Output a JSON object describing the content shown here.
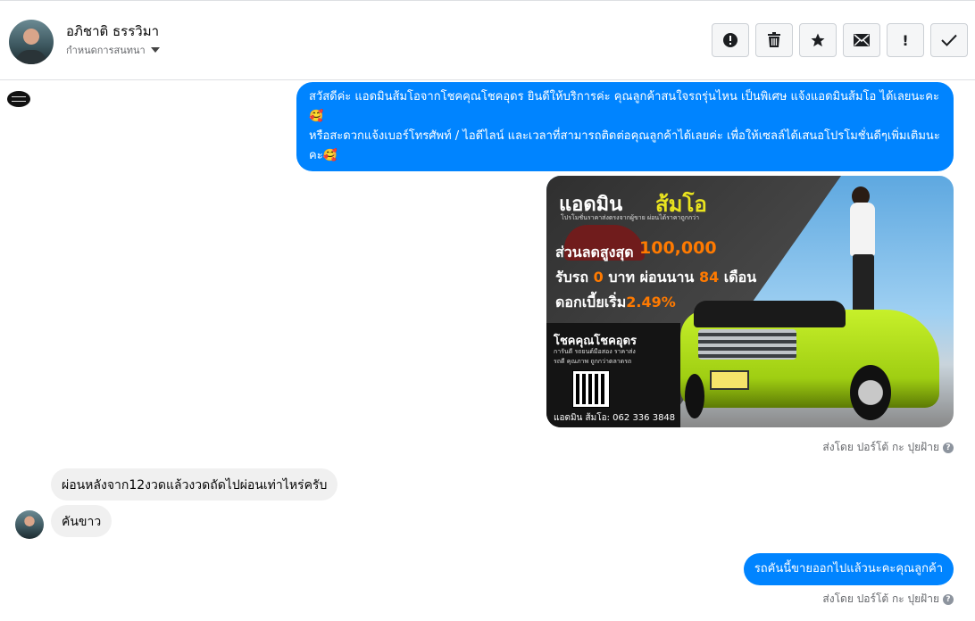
{
  "header": {
    "contact_name": "อภิชาติ ธรรวิมา",
    "assign_label": "กำหนดการสนทนา",
    "tools": [
      {
        "icon": "alert-circle-icon",
        "glyph": "!"
      },
      {
        "icon": "trash-icon"
      },
      {
        "icon": "star-icon",
        "glyph": "★"
      },
      {
        "icon": "envelope-icon"
      },
      {
        "icon": "exclamation-icon",
        "glyph": "!"
      },
      {
        "icon": "check-icon",
        "glyph": "✓"
      }
    ]
  },
  "messages": {
    "greeting": "สวัสดีค่ะ แอดมินส้มโอจากโชคคุณโชคอุดร ยินดีให้บริการค่ะ  คุณลูกค้าสนใจรถรุ่นไหน เป็นพิเศษ แจ้งแอดมินส้มโอ ได้เลยนะคะ🥰\nหรือสะดวกแจ้งเบอร์โทรศัพท์ / ไอดีไลน์ และเวลาที่สามารถติดต่อคุณลูกค้าได้เลยค่ะ เพื่อให้เซลล์ได้เสนอโปรโมชั่นดีๆเพิ่มเติมนะคะ🥰",
    "sent_by_1": "ส่งโดย ปอร์โต้ กะ ปุยฝ้าย",
    "customer_1": "ผ่อนหลังจาก12งวดแล้วงวดถัดไปผ่อนเท่าไหร่ครับ",
    "customer_2": "คันขาว",
    "reply": "รถคันนี้ขายออกไปแล้วนะคะคุณลูกค้า",
    "sent_by_2": "ส่งโดย ปอร์โต้ กะ ปุยฝ้าย",
    "help_glyph": "?"
  },
  "promo": {
    "brand_a": "แอดมิน",
    "brand_b": "ส้มโอ",
    "tagline": "โปรโมชั่นราคาส่งตรงจากผู้ขาย ผ่อนได้ราคาถูกกว่า",
    "discount_label": "ส่วนลดสูงสุด",
    "discount_value": "100,000",
    "line2_a": "รับรถ",
    "line2_b": "0",
    "line2_c": "บาท ผ่อนนาน",
    "line2_d": "84",
    "line2_e": "เดือน",
    "line3_a": "ดอกเบี้ยเริ่ม",
    "line3_b": "2.49%",
    "dealer": "โชคคุณโชคอุดร",
    "dealer_sub1": "การันตี รถยนต์มือสอง ราคาส่ง",
    "dealer_sub2": "รถดี คุณภาพ ถูกกว่าตลาดรถ",
    "contact": "แอดมิน ส้มโอ: 062 336 3848"
  }
}
